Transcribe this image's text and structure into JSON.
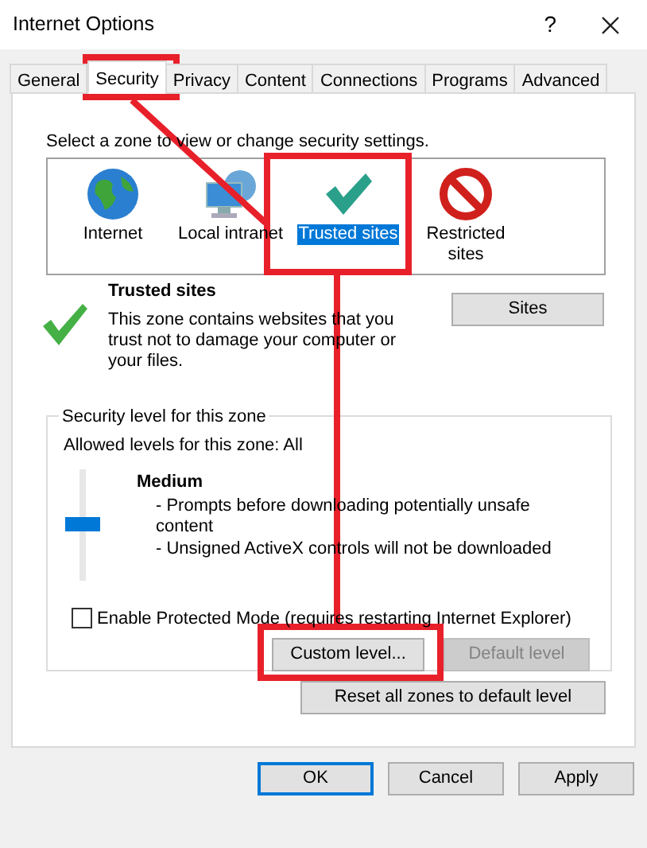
{
  "window": {
    "title": "Internet Options",
    "help": "?"
  },
  "tabs": [
    {
      "label": "General",
      "selected": false
    },
    {
      "label": "Security",
      "selected": true
    },
    {
      "label": "Privacy",
      "selected": false
    },
    {
      "label": "Content",
      "selected": false
    },
    {
      "label": "Connections",
      "selected": false
    },
    {
      "label": "Programs",
      "selected": false
    },
    {
      "label": "Advanced",
      "selected": false
    }
  ],
  "zone_prompt": "Select a zone to view or change security settings.",
  "zones": [
    {
      "kind": "globe",
      "label": "Internet",
      "selected": false
    },
    {
      "kind": "intranet",
      "label": "Local intranet",
      "selected": false
    },
    {
      "kind": "trusted",
      "label": "Trusted sites",
      "selected": true
    },
    {
      "kind": "restricted",
      "label": "Restricted sites",
      "selected": false
    }
  ],
  "zone_info": {
    "title": "Trusted sites",
    "description": "This zone contains websites that you trust not to damage your computer or your files.",
    "sites_button": "Sites"
  },
  "security_level": {
    "legend": "Security level for this zone",
    "allowed": "Allowed levels for this zone: All",
    "level": 0.5,
    "level_name": "Medium",
    "bullets": [
      "- Prompts before downloading potentially unsafe content",
      "- Unsigned ActiveX controls will not be downloaded"
    ],
    "protected_mode": {
      "label": "Enable Protected Mode (requires restarting Internet Explorer)",
      "checked": false
    },
    "custom_button": {
      "label": "Custom level...",
      "disabled": false
    },
    "default_button": {
      "label": "Default level",
      "disabled": true
    }
  },
  "reset_button": "Reset all zones to default level",
  "footer_buttons": [
    {
      "label": "OK",
      "default": true
    },
    {
      "label": "Cancel",
      "default": false
    },
    {
      "label": "Apply",
      "default": false
    }
  ]
}
